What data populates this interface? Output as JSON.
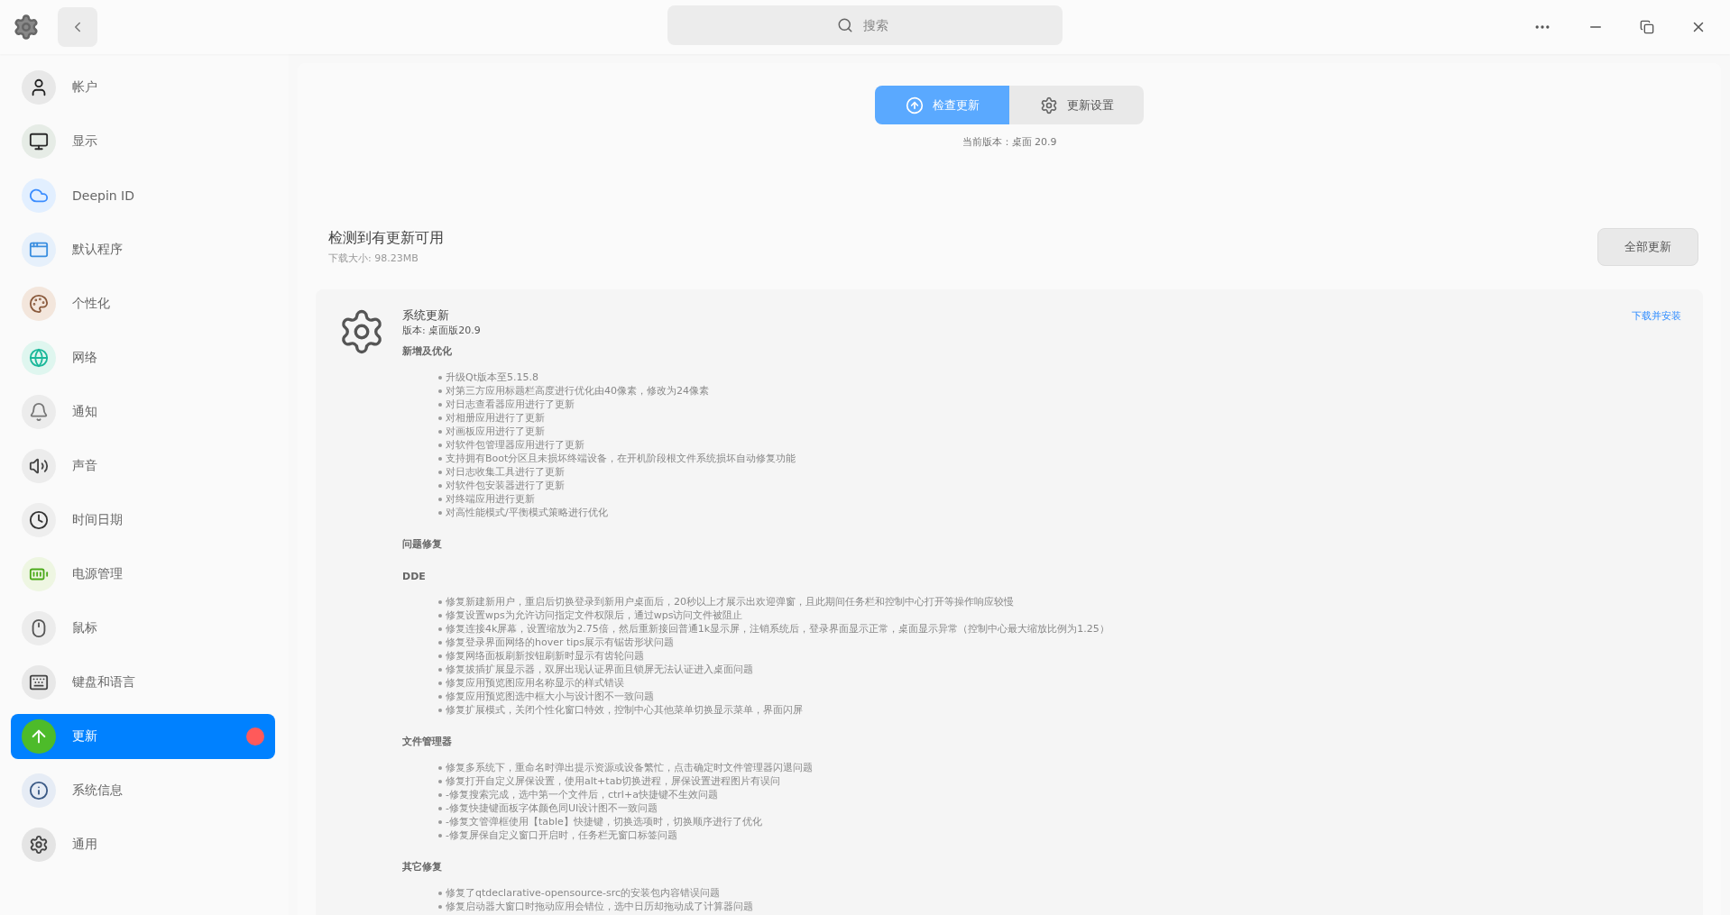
{
  "window": {
    "search_placeholder": "搜索"
  },
  "sidebar": {
    "items": [
      {
        "label": "帐户",
        "selected": false,
        "badge": false
      },
      {
        "label": "显示",
        "selected": false,
        "badge": false
      },
      {
        "label": "Deepin ID",
        "selected": false,
        "badge": false
      },
      {
        "label": "默认程序",
        "selected": false,
        "badge": false
      },
      {
        "label": "个性化",
        "selected": false,
        "badge": false
      },
      {
        "label": "网络",
        "selected": false,
        "badge": false
      },
      {
        "label": "通知",
        "selected": false,
        "badge": false
      },
      {
        "label": "声音",
        "selected": false,
        "badge": false
      },
      {
        "label": "时间日期",
        "selected": false,
        "badge": false
      },
      {
        "label": "电源管理",
        "selected": false,
        "badge": false
      },
      {
        "label": "鼠标",
        "selected": false,
        "badge": false
      },
      {
        "label": "键盘和语言",
        "selected": false,
        "badge": false
      },
      {
        "label": "更新",
        "selected": true,
        "badge": true
      },
      {
        "label": "系统信息",
        "selected": false,
        "badge": false
      },
      {
        "label": "通用",
        "selected": false,
        "badge": false
      }
    ]
  },
  "tabs": [
    {
      "label": "检查更新",
      "selected": true
    },
    {
      "label": "更新设置",
      "selected": false
    }
  ],
  "current_version": "当前版本：桌面 20.9",
  "summary": {
    "title": "检测到有更新可用",
    "size": "下载大小: 98.23MB",
    "button": "全部更新"
  },
  "update": {
    "name": "系统更新",
    "version": "版本: 桌面版20.9",
    "action": "下载并安装",
    "sections": [
      {
        "heading": "新增及优化",
        "items": [
          "升级Qt版本至5.15.8",
          "对第三方应用标题栏高度进行优化由40像素，修改为24像素",
          "对日志查看器应用进行了更新",
          "对相册应用进行了更新",
          "对画板应用进行了更新",
          "对软件包管理器应用进行了更新",
          "支持拥有Boot分区且未损坏终端设备，在开机阶段根文件系统损坏自动修复功能",
          "对日志收集工具进行了更新",
          "对软件包安装器进行了更新",
          "对终端应用进行更新",
          "对高性能模式/平衡模式策略进行优化"
        ]
      },
      {
        "heading": "问题修复"
      },
      {
        "heading": "DDE",
        "items": [
          "修复新建新用户，重启后切换登录到新用户桌面后，20秒以上才展示出欢迎弹窗，且此期间任务栏和控制中心打开等操作响应较慢",
          "修复设置wps为允许访问指定文件权限后，通过wps访问文件被阻止",
          "修复连接4k屏幕，设置缩放为2.75倍，然后重新接回普通1k显示屏，注销系统后，登录界面显示正常，桌面显示异常（控制中心最大缩放比例为1.25）",
          "修复登录界面网络的hover tips展示有锯齿形状问题",
          "修复网络面板刷新按钮刷新时显示有齿轮问题",
          "修复拔插扩展显示器，双屏出现认证界面且锁屏无法认证进入桌面问题",
          "修复应用预览图应用名称显示的样式错误",
          "修复应用预览图选中框大小与设计图不一致问题",
          "修复扩展模式，关闭个性化窗口特效，控制中心其他菜单切换显示菜单，界面闪屏"
        ]
      },
      {
        "heading": "文件管理器",
        "items": [
          "修复多系统下，重命名时弹出提示资源或设备繁忙，点击确定时文件管理器闪退问题",
          "修复打开自定义屏保设置，使用alt+tab切换进程，屏保设置进程图片有误问",
          "-修复搜索完成，选中第一个文件后，ctrl+a快捷键不生效问题",
          "-修复快捷键面板字体颜色同UI设计图不一致问题",
          "-修复文管弹框使用【table】快捷键，切换选项时，切换顺序进行了优化",
          "-修复屏保自定义窗口开启时，任务栏无窗口标签问题"
        ]
      },
      {
        "heading": "其它修复",
        "items": [
          "修复了qtdeclarative-opensource-src的安装包内容错误问题",
          "修复启动器大窗口时拖动应用会错位，选中日历却拖动成了计算器问题"
        ]
      }
    ]
  }
}
